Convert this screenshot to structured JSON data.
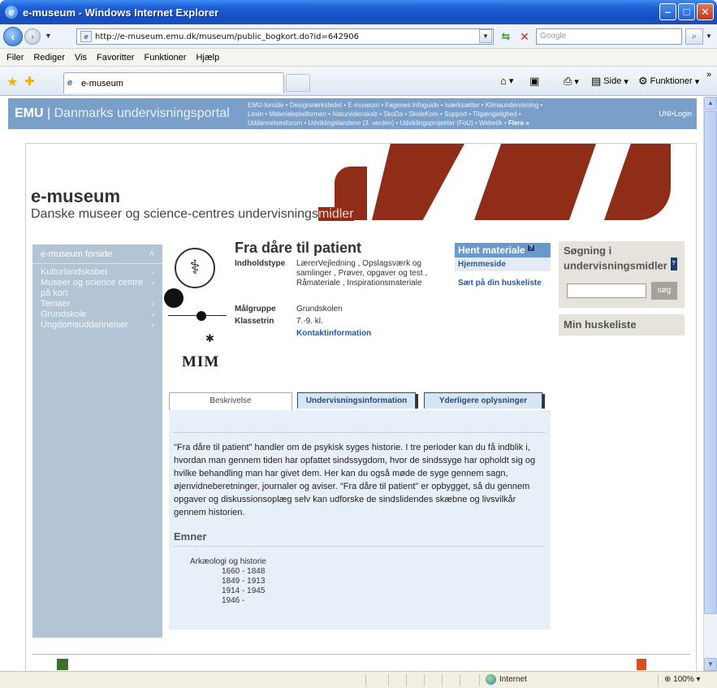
{
  "window": {
    "title": "e-museum - Windows Internet Explorer",
    "min": "–",
    "max": "□",
    "close": "✕"
  },
  "address": {
    "url": "http://e-museum.emu.dk/museum/public_bogkort.do?id=642906",
    "search_placeholder": "Google",
    "refresh_glyph": "⇆",
    "stop_glyph": "✕",
    "search_glyph": "⌕"
  },
  "menu": [
    "Filer",
    "Rediger",
    "Vis",
    "Favoritter",
    "Funktioner",
    "Hjælp"
  ],
  "tab": {
    "label": "e-museum"
  },
  "commands": {
    "page": "Side",
    "tools": "Funktioner"
  },
  "emu": {
    "logo_bold": "EMU",
    "logo_rest": "Danmarks undervisningsportal",
    "links_line1": "EMU-forside • Designværkstedet • E-museum • Fagenes Infoguide • Iværksætter • Klimaundervisning •",
    "links_line2": "Lexin • Materialeplatformen • Naturvidenskab • SkoDa • SkoleKom • Support • Tilgængelighed •",
    "links_line3": "Uddannelsesforum • Udviklingslandene (3. verden) • Udviklingsprojekter (FoU) • Webetik •",
    "links_more": "Flere »",
    "login": "UNI•Login"
  },
  "hero": {
    "title": "e-museum",
    "subtitle_main": "Danske museer og science-centres undervisnings",
    "subtitle_highlight": "midler"
  },
  "sidebar": {
    "head": "e-museum forside",
    "items": [
      {
        "label": "Kulturlandskabet",
        "arrow": "›"
      },
      {
        "label": "Museer og science centre",
        "arrow": "›"
      },
      {
        "label": "på kort",
        "arrow": ""
      },
      {
        "label": "Temaer",
        "arrow": "›"
      },
      {
        "label": "Grundskole",
        "arrow": "›"
      },
      {
        "label": "Ungdomsuddannelser",
        "arrow": "›"
      }
    ]
  },
  "product": {
    "title": "Fra dåre til patient",
    "logo_text": "MIM",
    "indholdstype_label": "Indholdstype",
    "indholdstype_value": "LærerVejledning , Opslagsværk og samlinger , Prøver, opgaver og test , Råmateriale , Inspirationsmateriale",
    "malgruppe_label": "Målgruppe",
    "malgruppe_value": "Grundskolen",
    "klassetrin_label": "Klassetrin",
    "klassetrin_value": "7.-9. kl.",
    "kontakt": "Kontaktinformation"
  },
  "hent": {
    "title": "Hent materiale",
    "help": "?",
    "hjemmeside": "Hjemmeside",
    "huskeliste": "Sæt på din huskeliste"
  },
  "search": {
    "title_line1": "Søgning i",
    "title_line2": "undervisningsmidler",
    "help": "?",
    "button": "søg",
    "min_huskeliste": "Min huskeliste"
  },
  "tabs": [
    "Beskrivelse",
    "Undervisningsinformation",
    "Yderligere oplysninger"
  ],
  "content": {
    "description": "\"Fra dåre til patient\" handler om de psykisk syges historie. I tre perioder kan du få indblik i, hvordan man gennem tiden har opfattet sindssygdom, hvor de sindssyge har opholdt sig og hvilke behandling man har givet dem. Her kan du også møde de syge gennem sagn, øjenvidneberetninger, journaler og aviser. \"Fra dåre til patient\" er opbygget, så du gennem opgaver og diskussionsoplæg selv kan udforske de sindslidendes skæbne og livsvilkår gennem historien.",
    "emner_heading": "Emner",
    "category": "Arkæologi og historie",
    "periods": [
      "1660 - 1848",
      "1849 - 1913",
      "1914 - 1945",
      "1946 -"
    ]
  },
  "status": {
    "zone": "Internet",
    "zoom": "100%"
  }
}
